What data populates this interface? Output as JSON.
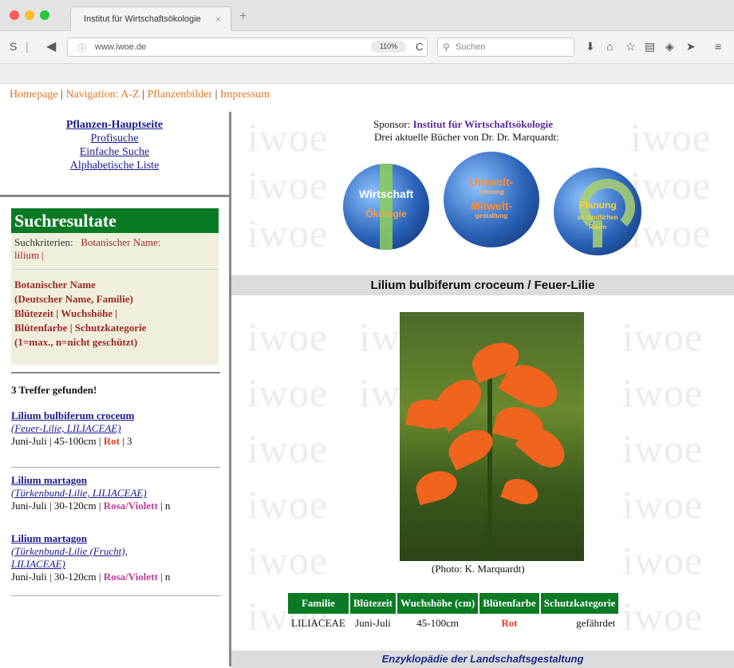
{
  "browser": {
    "tab_title": "Institut für Wirtschaftsökologie",
    "tab_close": "×",
    "new_tab": "+",
    "url": "www.iwoe.de",
    "zoom": "110%",
    "search_placeholder": "Suchen"
  },
  "topnav": {
    "homepage": "Homepage",
    "navigation": "Navigation: A-Z",
    "pflanzenbilder": "Pflanzenbilder",
    "impressum": "Impressum",
    "separator": " | "
  },
  "sidebar": {
    "links": [
      "Pflanzen-Hauptseite",
      "Profisuche",
      "Einfache Suche",
      "Alphabetische Liste"
    ],
    "result_title": "Suchresultate",
    "criteria_label": "Suchkriterien:",
    "criteria_value": "Botanischer Name:",
    "criteria_value2": "lilium |",
    "legend": [
      "Botanischer Name",
      "(Deutscher Name, Familie)",
      "Blütezeit | Wuchshöhe |",
      "Blütenfarbe | Schutzkategorie",
      "(1=max., n=nicht geschützt)"
    ],
    "hits_count": "3 Treffer gefunden!",
    "hits": [
      {
        "name": "Lilium bulbiferum croceum",
        "sub": "(Feuer-Lilie, LILIACEAE)",
        "sub2": "",
        "info": "Juni-Juli | 45-100cm | ",
        "color_label": "Rot",
        "color_class": "red",
        "cat": " | 3"
      },
      {
        "name": "Lilium martagon",
        "sub": "(Türkenbund-Lilie, LILIACEAE)",
        "sub2": "",
        "info": "Juni-Juli | 30-120cm | ",
        "color_label": "Rosa/Violett",
        "color_class": "pink",
        "cat": " | n"
      },
      {
        "name": "Lilium martagon",
        "sub": "(Türkenbund-Lilie (Frucht),",
        "sub2": "LILIACEAE)",
        "info": "Juni-Juli | 30-120cm | ",
        "color_label": "Rosa/Violett",
        "color_class": "pink",
        "cat": " | n"
      }
    ]
  },
  "main": {
    "watermark": "iwoe",
    "sponsor_label": "Sponsor:",
    "sponsor_name": "Institut für Wirtschaftsökologie",
    "books_line": "Drei aktuelle Bücher von Dr. Dr. Marquardt:",
    "globes": [
      {
        "line1": "Wirtschaft",
        "line2": "Ökologie"
      },
      {
        "line1": "Umwelt-",
        "line2": "Mitwelt-",
        "line3": "planung",
        "line4": "gestaltung"
      },
      {
        "line1": "Planung",
        "line2": "im ländlichen",
        "line3": "Raum"
      }
    ],
    "plant_title": "Lilium bulbiferum croceum / Feuer-Lilie",
    "photo_caption": "(Photo: K. Marquardt)",
    "table_headers": [
      "Familie",
      "Blütezeit",
      "Wuchshöhe (cm)",
      "Blütenfarbe",
      "Schutzkategorie"
    ],
    "table_row": [
      "LILIACEAE",
      "Juni-Juli",
      "45-100cm",
      "Rot",
      "gefährdet"
    ],
    "footer_banner": "Enzyklopädie der Landschaftsgestaltung"
  },
  "colors": {
    "accent_green": "#0a7a24",
    "nav_orange": "#e07820",
    "link_blue": "#1a1a8c",
    "red_value": "#e04020",
    "pink_value": "#c03a9a"
  }
}
